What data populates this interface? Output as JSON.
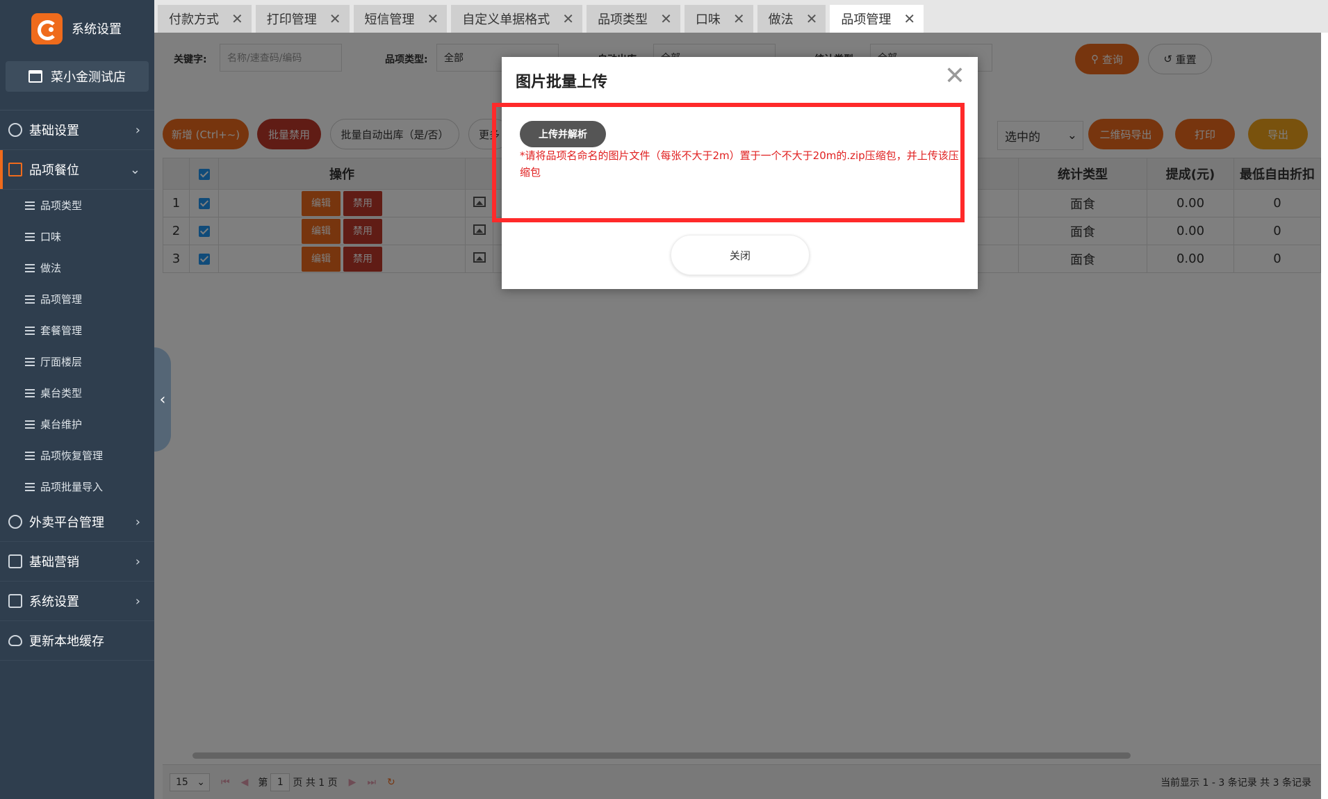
{
  "sidebar": {
    "brand_title": "系统设置",
    "store_name": "菜小金测试店",
    "menu": [
      {
        "label": "基础设置"
      },
      {
        "label": "品项餐位"
      },
      {
        "label": "外卖平台管理"
      },
      {
        "label": "基础营销"
      },
      {
        "label": "系统设置"
      },
      {
        "label": "更新本地缓存"
      }
    ],
    "submenu": [
      "品项类型",
      "口味",
      "做法",
      "品项管理",
      "套餐管理",
      "厅面楼层",
      "桌台类型",
      "桌台维护",
      "品项恢复管理",
      "品项批量导入"
    ]
  },
  "tabs": [
    "付款方式",
    "打印管理",
    "短信管理",
    "自定义单据格式",
    "品项类型",
    "口味",
    "做法",
    "品项管理"
  ],
  "filters": {
    "keyword_label": "关键字:",
    "keyword_placeholder": "名称/速查码/编码",
    "type_label": "品项类型:",
    "type_value": "全部",
    "auto_label": "自动出库:",
    "auto_value": "全部",
    "stat_label": "统计类型:",
    "stat_value": "全部",
    "query": "查询",
    "reset": "重置"
  },
  "toolbar": {
    "add": "新增 (Ctrl+~)",
    "batch_disable": "批量禁用",
    "batch_auto": "批量自动出库（是/否）",
    "more": "更多",
    "selected": "选中的",
    "qr_export": "二维码导出",
    "print": "打印",
    "export": "导出"
  },
  "table": {
    "headers": {
      "op": "操作",
      "stat": "统计类型",
      "commission": "提成(元)",
      "discount": "最低自由折扣"
    },
    "edit": "编辑",
    "disable": "禁用",
    "rows": [
      {
        "n": "1",
        "stat": "面食",
        "commission": "0.00",
        "discount": "0"
      },
      {
        "n": "2",
        "stat": "面食",
        "commission": "0.00",
        "discount": "0"
      },
      {
        "n": "3",
        "stat": "面食",
        "commission": "0.00",
        "discount": "0"
      }
    ]
  },
  "pager": {
    "size": "15",
    "page_prefix": "第",
    "page": "1",
    "page_suffix": "页 共 1 页",
    "summary": "当前显示 1 - 3 条记录 共 3 条记录"
  },
  "modal": {
    "title": "图片批量上传",
    "upload": "上传并解析",
    "tip": "*请将品项名命名的图片文件（每张不大于2m）置于一个不大于20m的.zip压缩包，并上传该压缩包",
    "close": "关闭"
  },
  "colors": {
    "accent": "#ef6b1c",
    "danger": "#c0392b",
    "sidebar": "#2f3e4e",
    "highlight": "#ff2a2a"
  }
}
